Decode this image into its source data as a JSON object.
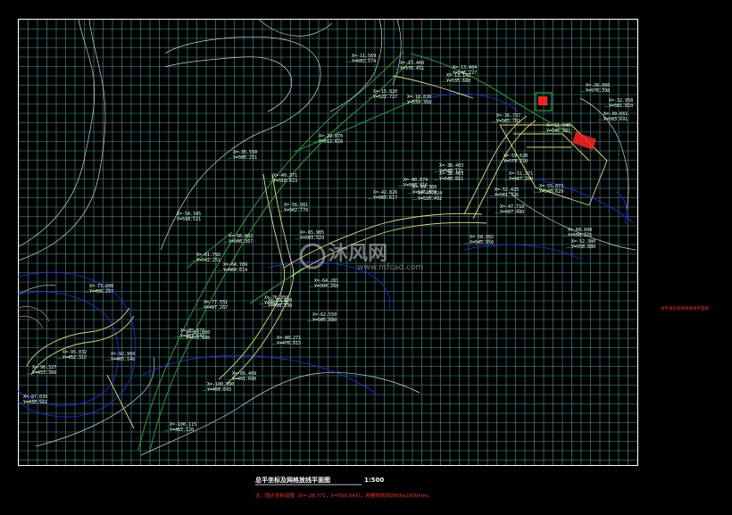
{
  "drawing": {
    "title": "总平坐标及网格放线平面图",
    "scale": "1:500",
    "note": "注：园点坐标设置（X=-28.771，Y=560.543），网格放线间2000x2000mm。",
    "side_label": "总平坐标及网格放线平面图",
    "watermark": {
      "brand": "沐风网",
      "url": "www.mfcad.com"
    },
    "colors": {
      "background": "#000000",
      "grid": "#2ea59a",
      "frame": "#ffffff",
      "path_edge": "#e6e05a",
      "road": "#cfcfcf",
      "contour_blue": "#2a2aff",
      "leader_green": "#2fbf2f",
      "highlight_red": "#ff2020"
    }
  },
  "coordinate_labels": [
    {
      "x": "X=-11.569",
      "y": "Y=602.574"
    },
    {
      "x": "X=-13.460",
      "y": "Y=576.451"
    },
    {
      "x": "X=-13.484",
      "y": "Y=546.227"
    },
    {
      "x": "X=-13.142",
      "y": "Y=535.680"
    },
    {
      "x": "X=-15.820",
      "y": "Y=522.727"
    },
    {
      "x": "X=-18.830",
      "y": "Y=539.368"
    },
    {
      "x": "X=-28.966",
      "y": "Y=576.398"
    },
    {
      "x": "X=-29.870",
      "y": "Y=512.616"
    },
    {
      "x": "X=-35.550",
      "y": "Y=585.251"
    },
    {
      "x": "X=-36.737",
      "y": "Y=565.781"
    },
    {
      "x": "X=-40.271",
      "y": "Y=518.623"
    },
    {
      "x": "X=-38.403",
      "y": "Y=548.121"
    },
    {
      "x": "X=-38.403",
      "y": "Y=545.661"
    },
    {
      "x": "X=-40.874",
      "y": "Y=568.416"
    },
    {
      "x": "X=-42.826",
      "y": "Y=565.617"
    },
    {
      "x": "X=-47.324",
      "y": "Y=526.492"
    },
    {
      "x": "X=-51.348",
      "y": "Y=546.381"
    },
    {
      "x": "X=-51.371",
      "y": "Y=567.200"
    },
    {
      "x": "X=-52.425",
      "y": "Y=561.326"
    },
    {
      "x": "X=-54.345",
      "y": "Y=518.521"
    },
    {
      "x": "X=-55.873",
      "y": "Y=540.629"
    },
    {
      "x": "X=-56.082",
      "y": "Y=508.367"
    },
    {
      "x": "X=-58.902",
      "y": "Y=545.956"
    },
    {
      "x": "X=-60.600",
      "y": "Y=558.325"
    },
    {
      "x": "X=-61.792",
      "y": "Y=542.251"
    },
    {
      "x": "X=-64.281",
      "y": "Y=504.260"
    },
    {
      "x": "X=-64.709",
      "y": "Y=484.814"
    },
    {
      "x": "X=-65.905",
      "y": "Y=503.529"
    },
    {
      "x": "X=-73.000",
      "y": "Y=456.257"
    },
    {
      "x": "X=-76.950",
      "y": "Y=483.173"
    },
    {
      "x": "X=-77.551",
      "y": "Y=497.267"
    },
    {
      "x": "X=-80.271",
      "y": "Y=476.815"
    },
    {
      "x": "X=-85.377",
      "y": "Y=487.542"
    },
    {
      "x": "X=-85.409",
      "y": "Y=491.600"
    },
    {
      "x": "X=-87.039",
      "y": "Y=430.561"
    },
    {
      "x": "X=-92.960",
      "y": "Y=465.146"
    },
    {
      "x": "X=-95.032",
      "y": "Y=452.317"
    },
    {
      "x": "X=-96.327",
      "y": "Y=453.360"
    },
    {
      "x": "X=-100.115",
      "y": "Y=483.120"
    },
    {
      "x": "X=-100.890",
      "y": "Y=450.043"
    },
    {
      "x": "X=-30.661",
      "y": "Y=583.691"
    },
    {
      "x": "X=-32.958",
      "y": "Y=581.810"
    },
    {
      "x": "X=-47.710",
      "y": "Y=567.480"
    },
    {
      "x": "X=-49.360",
      "y": "Y=546.680"
    },
    {
      "x": "X=-52.340",
      "y": "Y=558.880"
    },
    {
      "x": "X=-56.981",
      "y": "Y=562.770"
    },
    {
      "x": "X=-59.620",
      "y": "Y=579.210"
    },
    {
      "x": "X=-62.550",
      "y": "Y=505.880"
    },
    {
      "x": "X=-69.400",
      "y": "Y=498.330"
    },
    {
      "x": "X=-83.860",
      "y": "Y=473.100"
    }
  ]
}
